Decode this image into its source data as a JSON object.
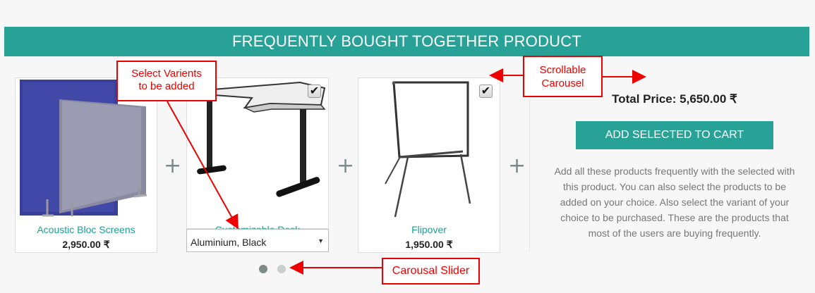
{
  "section": {
    "title": "FREQUENTLY BOUGHT TOGETHER PRODUCT"
  },
  "products": [
    {
      "name": "Acoustic Bloc Screens",
      "price": "2,950.00 ₹",
      "checked": false
    },
    {
      "name": "Customizable Desk",
      "price": "",
      "checked": true,
      "variant": "Aluminium, Black"
    },
    {
      "name": "Flipover",
      "price": "1,950.00 ₹",
      "checked": true
    }
  ],
  "separator": "+",
  "summary": {
    "total": "Total Price: 5,650.00 ₹",
    "add_button": "ADD SELECTED TO CART",
    "description": "Add all these products frequently with the selected with this product. You can also select the products to be added on your choice. Also select the variant of your choice to be purchased. These are the products that most of the users are buying frequently."
  },
  "carousel": {
    "dots": 2,
    "active": 0
  },
  "annotations": {
    "variants": "Select Varients to be added",
    "scrollable": "Scrollable Carousel",
    "slider": "Carousal Slider"
  },
  "colors": {
    "accent": "#28a197",
    "annotation": "#e00000"
  },
  "icons": [
    "checkbox-checked-icon",
    "dropdown-arrow-icon",
    "plus-icon"
  ]
}
